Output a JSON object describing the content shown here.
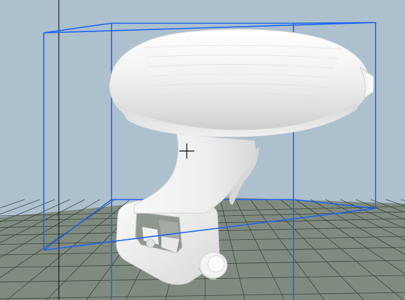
{
  "viewport": {
    "background_color": "#acc0ce",
    "floor_color": "#7f8b7f",
    "grid_line_color": "#2e352e",
    "bounding_box_color": "#1a63f0",
    "axis_line_color": "#000000",
    "model_color": "#f2f2f2",
    "cursor_icon": "crosshair-icon"
  }
}
